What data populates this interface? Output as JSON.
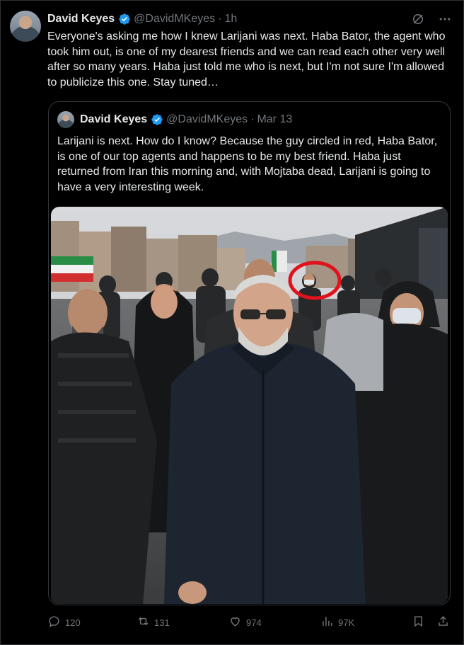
{
  "tweet": {
    "author_name": "David Keyes",
    "author_handle": "@DavidMKeyes",
    "separator": "·",
    "time": "1h",
    "text": "Everyone's asking me how I knew Larijani was next. Haba Bator, the agent who took him out, is one of my dearest friends and we can read each other very well after so many years. Haba just told me who is next, but I'm not sure I'm allowed to publicize this one. Stay tuned…"
  },
  "quoted": {
    "author_name": "David Keyes",
    "author_handle": "@DavidMKeyes",
    "separator": "·",
    "time": "Mar 13",
    "text": "Larijani is next. How do I know? Because the guy circled in red, Haba Bator, is one of our top agents and happens to be my best friend. Haba just returned from Iran this morning and, with Mojtaba dead, Larijani is going to have a very interesting week."
  },
  "metrics": {
    "replies": "120",
    "reposts": "131",
    "likes": "974",
    "views": "97K"
  },
  "icons": [
    "verified-badge-icon",
    "grok-icon",
    "more-icon",
    "reply-icon",
    "repost-icon",
    "like-icon",
    "views-icon",
    "bookmark-icon",
    "share-icon"
  ],
  "colors": {
    "background": "#000000",
    "text": "#e7e9ea",
    "secondary": "#71767b",
    "verified": "#1d9bf0",
    "border": "#2f3336",
    "circle_annotation": "#e0121b"
  }
}
